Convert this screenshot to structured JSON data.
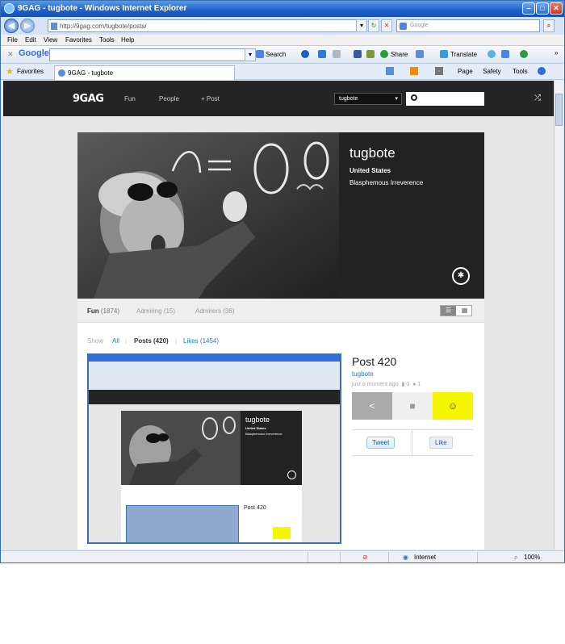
{
  "window": {
    "title": "9GAG - tugbote - Windows Internet Explorer"
  },
  "address": {
    "url": "http://9gag.com/tugbote/posts/",
    "search_placeholder": "Google"
  },
  "menu": [
    "File",
    "Edit",
    "View",
    "Favorites",
    "Tools",
    "Help"
  ],
  "google_toolbar": {
    "logo": "Google",
    "search": "Search",
    "share": "Share",
    "translate": "Translate"
  },
  "favorites_bar": {
    "label": "Favorites",
    "tab_title": "9GAG - tugbote",
    "page": "Page",
    "safety": "Safety",
    "tools": "Tools"
  },
  "site": {
    "logo": "9GAG",
    "nav": [
      "Fun",
      "People",
      "+ Post"
    ],
    "section_select": "tugbote"
  },
  "profile": {
    "username": "tugbote",
    "country": "United States",
    "motto": "Blasphemous Irreverence",
    "tabs": [
      {
        "label": "Fun",
        "count": "(1874)"
      },
      {
        "label": "Admiring",
        "count": "(15)"
      },
      {
        "label": "Admirers",
        "count": "(36)"
      }
    ],
    "filter": {
      "show": "Show",
      "all": "All",
      "posts": "Posts (420)",
      "likes": "Likes (1454)"
    }
  },
  "post": {
    "title": "Post 420",
    "user": "tugbote",
    "time": "just a moment ago",
    "points": "0",
    "comments": "1",
    "tweet": "Tweet",
    "like": "Like"
  },
  "thumb": {
    "username": "tugbote",
    "country": "United States",
    "motto": "Blasphemous Irreverence",
    "post_title": "Post 420"
  },
  "status": {
    "zone": "Internet",
    "zoom": "100%"
  },
  "colors": {
    "accent_yellow": "#f6f600",
    "header": "#242424",
    "link": "#1b7bc6"
  }
}
